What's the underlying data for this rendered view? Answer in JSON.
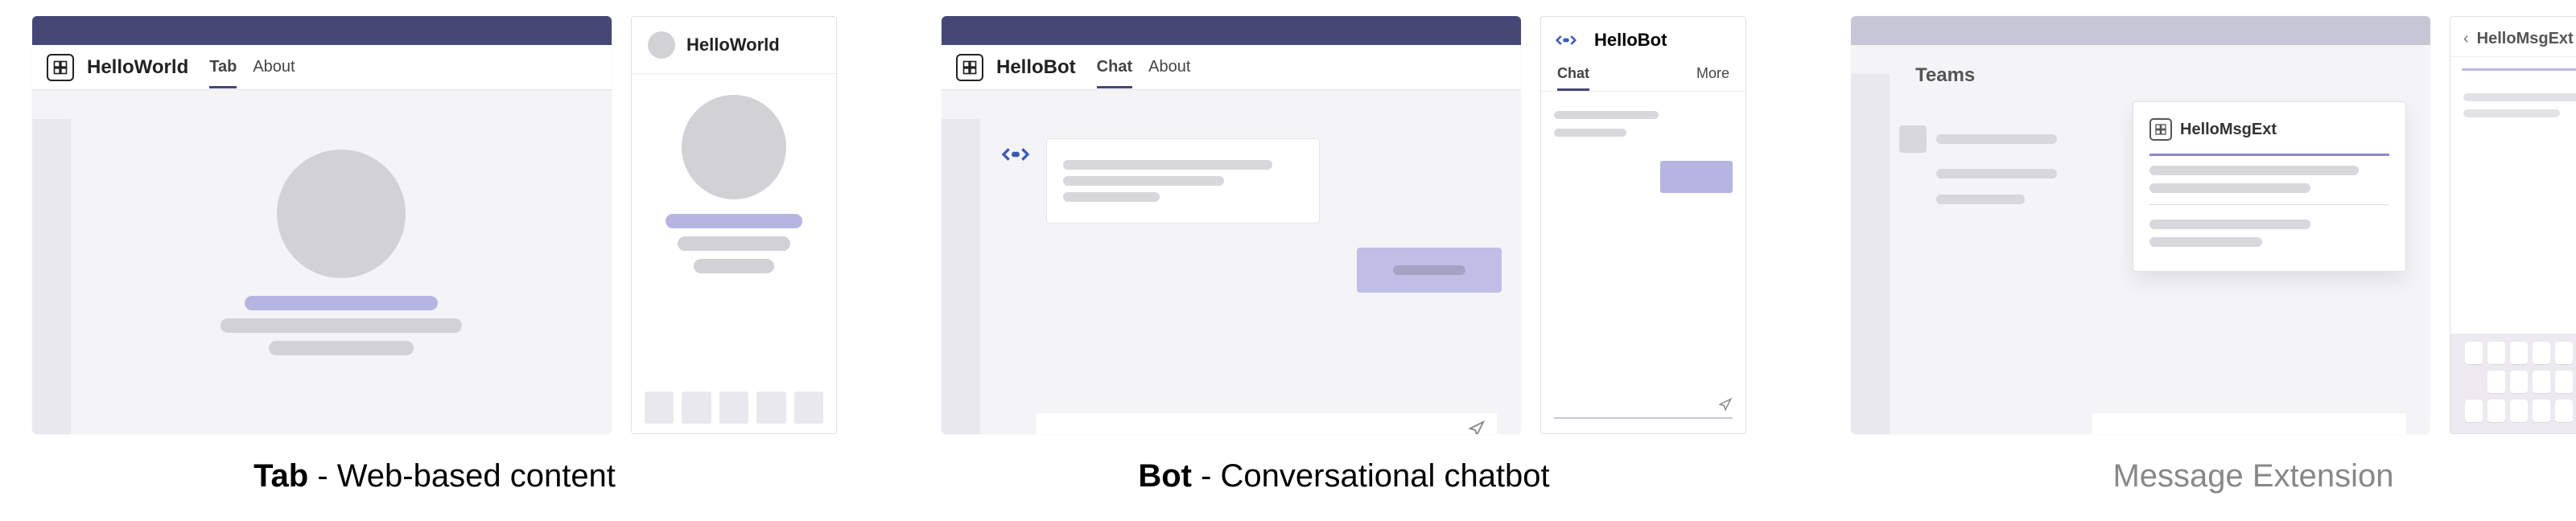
{
  "groups": {
    "tab": {
      "caption_bold": "Tab",
      "caption_rest": " - Web-based content",
      "desktop": {
        "app_title": "HelloWorld",
        "tabs": {
          "tab1": "Tab",
          "tab2": "About"
        }
      },
      "mobile": {
        "title": "HelloWorld"
      }
    },
    "bot": {
      "caption_bold": "Bot",
      "caption_rest": " - Conversational chatbot",
      "desktop": {
        "app_title": "HelloBot",
        "tabs": {
          "tab1": "Chat",
          "tab2": "About"
        }
      },
      "mobile": {
        "title": "HelloBot",
        "tabs": {
          "tab1": "Chat",
          "tab2": "More"
        }
      }
    },
    "msgext": {
      "caption": "Message Extension",
      "desktop": {
        "teams_label": "Teams",
        "popover_title": "HelloMsgExt"
      },
      "mobile": {
        "title": "HelloMsgExt"
      }
    }
  }
}
